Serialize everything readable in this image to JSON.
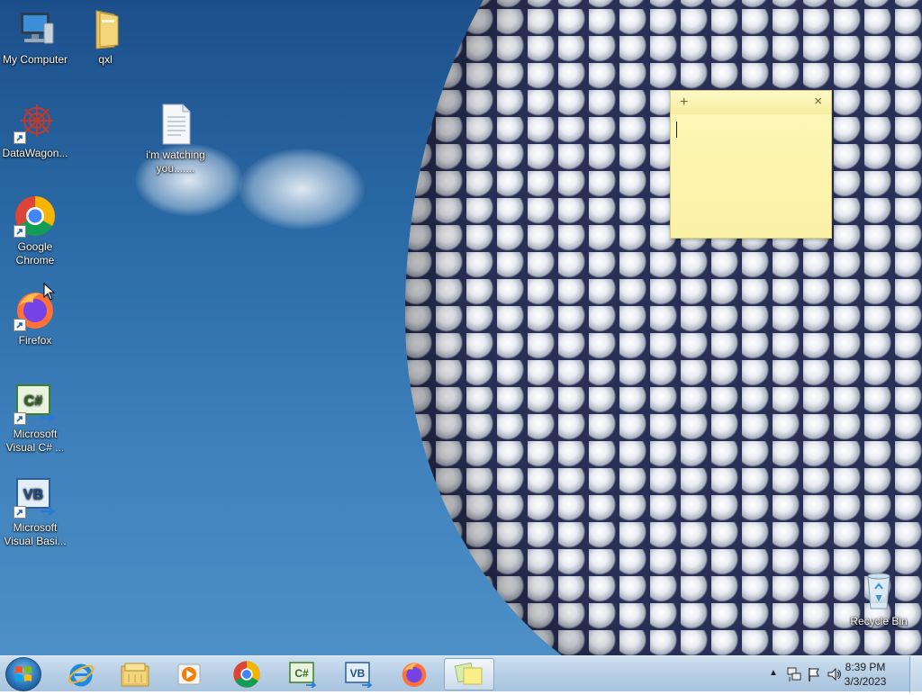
{
  "desktop": {
    "icons": [
      {
        "label": "My Computer",
        "icon": "computer-icon"
      },
      {
        "label": "qxl",
        "icon": "folder-icon"
      },
      {
        "label": "DataWagon...",
        "icon": "datawagon-icon"
      },
      {
        "label": "i'm watching you.......",
        "icon": "text-file-icon"
      },
      {
        "label": "Google Chrome",
        "icon": "chrome-icon"
      },
      {
        "label": "Firefox",
        "icon": "firefox-icon"
      },
      {
        "label": "Microsoft Visual C# ...",
        "icon": "visual-csharp-icon"
      },
      {
        "label": "Microsoft Visual Basi...",
        "icon": "visual-basic-icon"
      },
      {
        "label": "Recycle Bin",
        "icon": "recycle-bin-icon"
      }
    ]
  },
  "sticky_note": {
    "add_glyph": "+",
    "close_glyph": "×",
    "text": ""
  },
  "taskbar": {
    "pinned": [
      {
        "name": "internet-explorer",
        "icon": "internet-explorer-icon"
      },
      {
        "name": "windows-explorer",
        "icon": "file-explorer-icon"
      },
      {
        "name": "media-player",
        "icon": "media-player-icon"
      },
      {
        "name": "chrome",
        "icon": "chrome-icon"
      },
      {
        "name": "visual-csharp",
        "icon": "visual-csharp-icon"
      },
      {
        "name": "visual-basic",
        "icon": "visual-basic-icon"
      },
      {
        "name": "firefox",
        "icon": "firefox-icon"
      },
      {
        "name": "sticky-notes",
        "icon": "sticky-notes-icon",
        "active": true
      }
    ],
    "tray": {
      "time": "8:39 PM",
      "date": "3/3/2023",
      "icons": [
        "show-hidden-icons-icon",
        "network-icon",
        "action-center-flag-icon",
        "volume-icon"
      ]
    }
  },
  "colors": {
    "sky_top": "#1c4f8a",
    "sky_bottom": "#4d8fc6",
    "sticky_yellow": "#fbf2a6",
    "taskbar": "#b9d0e6"
  }
}
